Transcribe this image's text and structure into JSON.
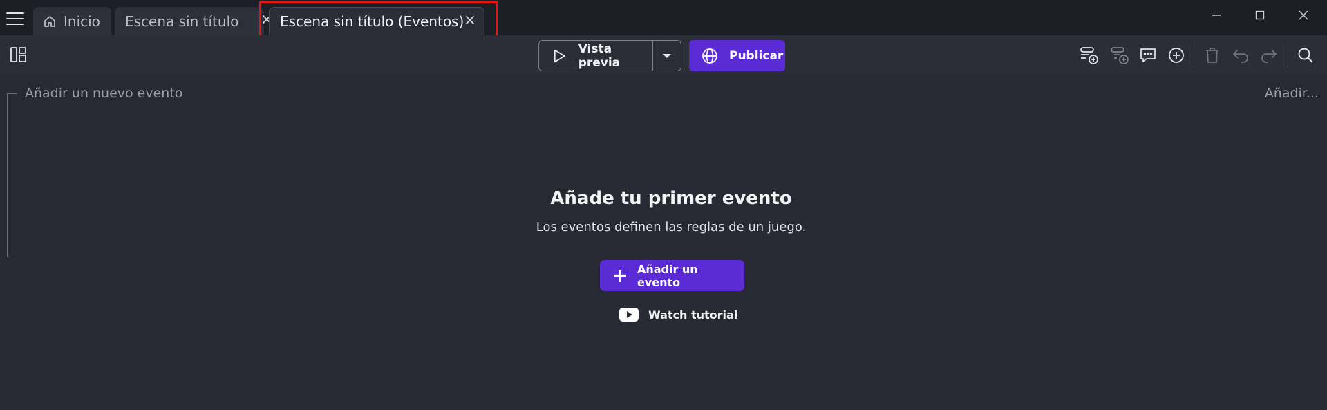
{
  "tabs": [
    {
      "label": "Inicio",
      "icon": "home-icon"
    },
    {
      "label": "Escena sin título",
      "close": "×"
    },
    {
      "label": "Escena sin título (Eventos)",
      "close": "×",
      "active": true
    }
  ],
  "toolbar": {
    "preview_label": "Vista previa",
    "publish_label": "Publicar",
    "icons": [
      "add-event-icon",
      "add-subevent-icon",
      "add-comment-icon",
      "add-other-icon",
      "delete-icon",
      "undo-icon",
      "redo-icon",
      "search-icon"
    ]
  },
  "events": {
    "add_placeholder": "Añadir un nuevo evento",
    "add_right": "Añadir..."
  },
  "empty_state": {
    "title": "Añade tu primer evento",
    "description": "Los eventos definen las reglas de un juego.",
    "add_button": "Añadir un evento",
    "tutorial_link": "Watch tutorial"
  },
  "colors": {
    "accent": "#5b2bd6",
    "highlight": "#e81414",
    "background": "#272a33",
    "titlebar": "#1d1f26"
  }
}
